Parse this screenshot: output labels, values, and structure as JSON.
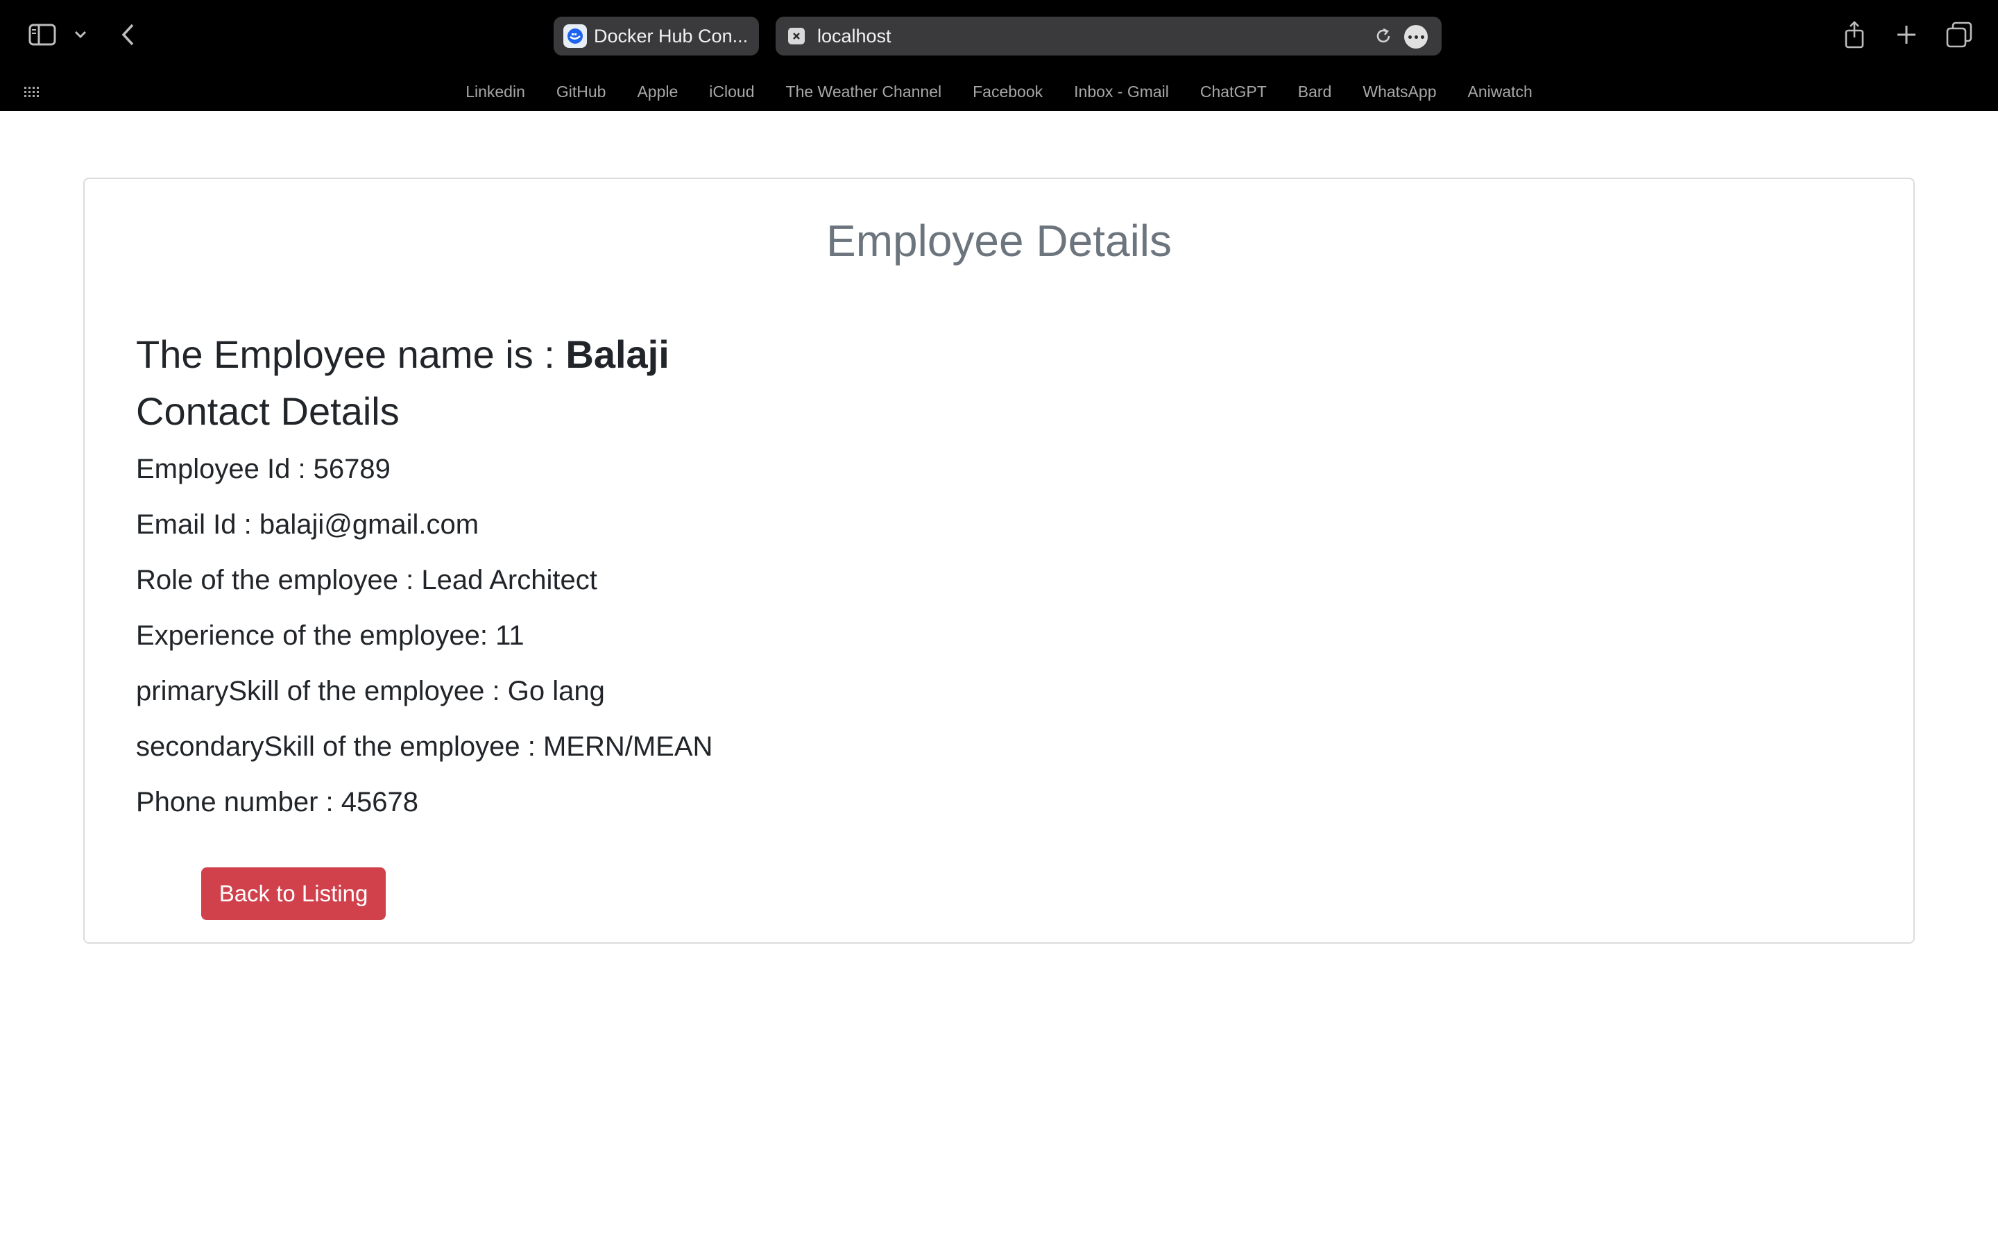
{
  "browser": {
    "tabs": [
      {
        "title": "Docker Hub Con...",
        "favicon": "docker-icon"
      }
    ],
    "url": "localhost",
    "bookmarks": [
      "Linkedin",
      "GitHub",
      "Apple",
      "iCloud",
      "The Weather Channel",
      "Facebook",
      "Inbox - Gmail",
      "ChatGPT",
      "Bard",
      "WhatsApp",
      "Aniwatch"
    ]
  },
  "page": {
    "title": "Employee Details",
    "name_prefix": "The Employee name is : ",
    "name": "Balaji",
    "contact_heading": "Contact Details",
    "details": {
      "employee_id": "Employee Id : 56789",
      "email": "Email Id : balaji@gmail.com",
      "role": "Role of the employee : Lead Architect",
      "experience": "Experience of the employee: 11",
      "primary_skill": "primarySkill of the employee : Go lang",
      "secondary_skill": "secondarySkill of the employee : MERN/MEAN",
      "phone": "Phone number : 45678"
    },
    "back_button_label": "Back to Listing"
  },
  "colors": {
    "accent_button": "#d0414c",
    "title": "#6c757d"
  }
}
